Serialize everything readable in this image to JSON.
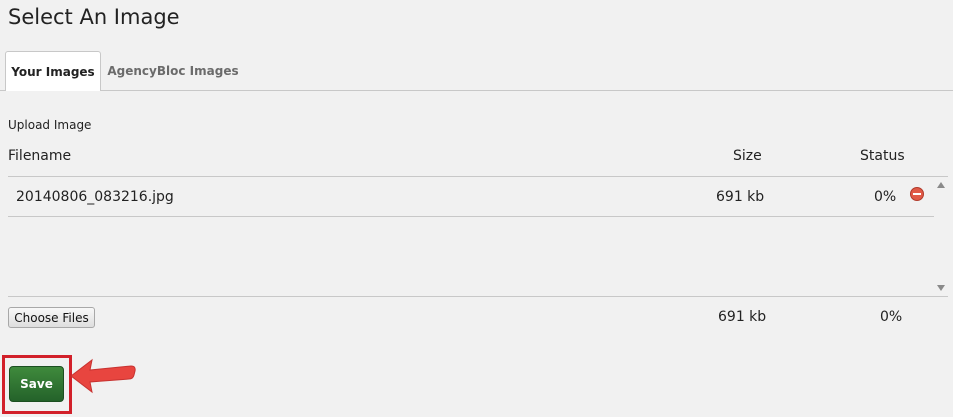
{
  "dialog": {
    "title": "Select An Image"
  },
  "tabs": [
    {
      "label": "Your Images",
      "active": true
    },
    {
      "label": "AgencyBloc Images",
      "active": false
    }
  ],
  "upload": {
    "label": "Upload Image",
    "columns": {
      "filename": "Filename",
      "size": "Size",
      "status": "Status"
    },
    "files": [
      {
        "name": "20140806_083216.jpg",
        "size": "691 kb",
        "status": "0%"
      }
    ],
    "choose_label": "Choose Files",
    "total_size": "691 kb",
    "total_status": "0%"
  },
  "actions": {
    "save_label": "Save"
  },
  "colors": {
    "save_green": "#2e7233",
    "highlight_red": "#d2202a",
    "remove_red": "#e05a47"
  }
}
